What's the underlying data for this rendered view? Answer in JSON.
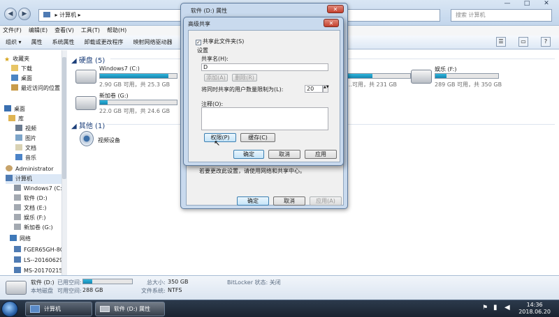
{
  "explorer": {
    "address": "▸ 计算机 ▸",
    "search_placeholder": "搜索 计算机",
    "window_controls": [
      "—",
      "□",
      "✕"
    ],
    "menu": [
      "文件(F)",
      "编辑(E)",
      "查看(V)",
      "工具(T)",
      "帮助(H)"
    ],
    "toolbar": [
      "组织 ▾",
      "属性",
      "系统属性",
      "卸载或更改程序",
      "映射网络驱动器"
    ],
    "nav": {
      "favorites": "收藏夹",
      "favorites_items": [
        "下载",
        "桌面",
        "最近访问的位置"
      ],
      "desktop": "桌面",
      "library": "库",
      "library_items": [
        "视频",
        "图片",
        "文档",
        "音乐"
      ],
      "admin": "Administrator",
      "computer": "计算机",
      "drives": [
        "Windows7 (C:)",
        "软件 (D:)",
        "文档 (E:)",
        "娱乐 (F:)",
        "新加卷 (G:)"
      ],
      "network": "网络",
      "network_items": [
        "FGER65GH-8C",
        "LS--20160629",
        "MS-20170215"
      ]
    },
    "hard_disks_header": "硬盘 (5)",
    "drives": [
      {
        "name": "Windows7 (C:)",
        "free": "2.90 GB 可用，共 25.3 GB",
        "used_fraction": 0.89
      },
      {
        "name": "新加卷 (G:)",
        "free": "22.0 GB 可用，共 24.6 GB",
        "used_fraction": 0.1
      },
      {
        "name": "",
        "free": "…可用，共 231 GB",
        "used_fraction": 0.4
      },
      {
        "name": "娱乐 (F:)",
        "free": "289 GB 可用，共 350 GB",
        "used_fraction": 0.18
      }
    ],
    "other_header": "其他 (1)",
    "other_items": [
      "视频设备"
    ],
    "status": {
      "drive_name": "软件 (D:)",
      "drive_type": "本地磁盘",
      "used_label": "已用空间:",
      "free_label": "可用空间:",
      "free_value": "288 GB",
      "total_label": "总大小:",
      "total_value": "350 GB",
      "fs_label": "文件系统:",
      "fs_value": "NTFS",
      "bitlocker": "BitLocker 状态: 关闭",
      "used_fraction": 0.18
    }
  },
  "props_dialog": {
    "title": "软件 (D:) 属性",
    "close": "✕",
    "hint_text": "若要更改此设置，请使用网络和共享中心。",
    "buttons": {
      "ok": "确定",
      "cancel": "取消",
      "apply": "应用(A)"
    }
  },
  "advanced_sharing": {
    "title": "高级共享",
    "close": "✕",
    "share_checkbox": "共享此文件夹(S)",
    "settings_label": "设置",
    "share_name_label": "共享名(H):",
    "share_name_value": "D",
    "add_button": "添加(A)",
    "remove_button": "删除(R)",
    "limit_label": "将同时共享的用户数量限制为(L):",
    "limit_value": "20",
    "comment_label": "注释(O):",
    "permissions_button": "权限(P)",
    "caching_button": "缓存(C)",
    "ok": "确定",
    "cancel": "取消",
    "apply": "应用"
  },
  "taskbar": {
    "tasks": [
      "计算机",
      "软件 (D:) 属性"
    ],
    "time": "14:36",
    "date": "2018.06.20"
  }
}
